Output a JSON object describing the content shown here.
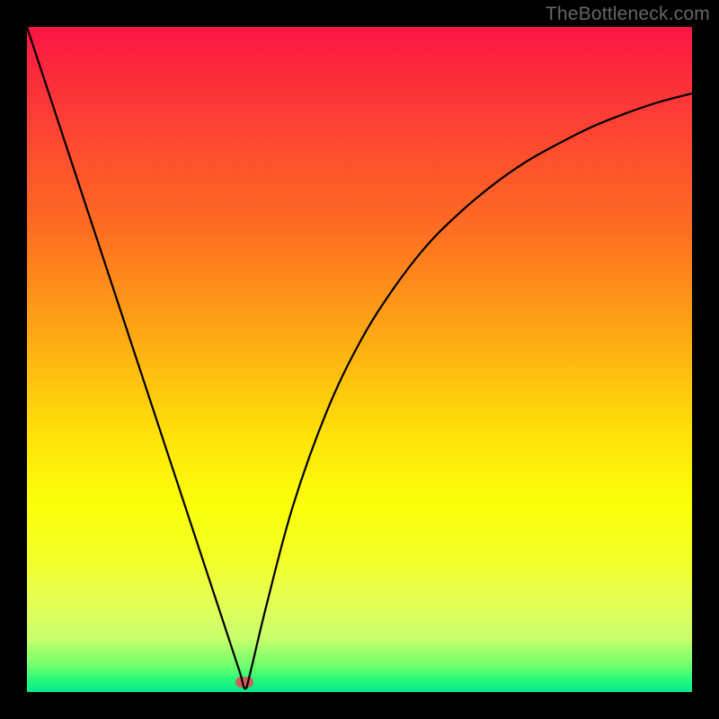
{
  "watermark": "TheBottleneck.com",
  "chart_data": {
    "type": "line",
    "title": "",
    "xlabel": "",
    "ylabel": "",
    "xlim": [
      0,
      1
    ],
    "ylim": [
      0,
      1
    ],
    "grid": false,
    "legend": false,
    "background_gradient": {
      "direction": "vertical",
      "stops": [
        {
          "pos": 0.0,
          "color": "#fb1545"
        },
        {
          "pos": 0.3,
          "color": "#fe6c22"
        },
        {
          "pos": 0.62,
          "color": "#fee409"
        },
        {
          "pos": 0.86,
          "color": "#e7ff53"
        },
        {
          "pos": 1.0,
          "color": "#00eb8c"
        }
      ]
    },
    "marker": {
      "x": 0.327,
      "y": 0.015,
      "color": "#ce5f5a"
    },
    "series": [
      {
        "name": "curve",
        "color": "#000000",
        "x": [
          0.0,
          0.033,
          0.066,
          0.099,
          0.132,
          0.165,
          0.198,
          0.231,
          0.264,
          0.297,
          0.32,
          0.328,
          0.336,
          0.36,
          0.4,
          0.45,
          0.5,
          0.55,
          0.6,
          0.65,
          0.7,
          0.75,
          0.8,
          0.85,
          0.9,
          0.95,
          1.0
        ],
        "y": [
          1.0,
          0.9,
          0.8,
          0.7,
          0.6,
          0.5,
          0.4,
          0.3,
          0.2,
          0.1,
          0.03,
          0.005,
          0.03,
          0.13,
          0.28,
          0.42,
          0.525,
          0.605,
          0.67,
          0.72,
          0.762,
          0.797,
          0.825,
          0.85,
          0.87,
          0.887,
          0.9
        ]
      }
    ]
  }
}
